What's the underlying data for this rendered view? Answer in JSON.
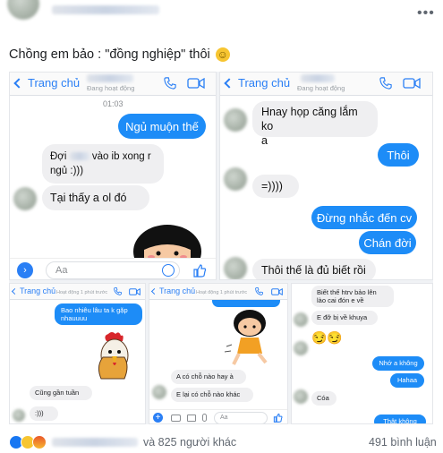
{
  "post": {
    "caption": "Chồng em bảo : \"đồng nghiệp\" thôi",
    "caption_emoji": "☺",
    "menu_icon": "ellipsis-icon"
  },
  "panel1": {
    "back_label": "Trang chủ",
    "status": "Đang hoạt động",
    "time": "01:03",
    "messages": {
      "out1": "Ngủ muộn thế",
      "in1_a": "Đợi",
      "in1_b": "vào ib xong r",
      "in1_c": "ngủ :)))",
      "in2": "Tại thấy a ol đó"
    },
    "composer_placeholder": "Aa"
  },
  "panel2": {
    "back_label": "Trang chủ",
    "status": "Đang hoạt động",
    "messages": {
      "in1_a": "Hnay họp căng lắm ko",
      "in1_b": "a",
      "out1": "Thôi",
      "in2": "=))))",
      "out2": "Đừng nhắc đến cv",
      "out3": "Chán đời",
      "in3": "Thôi thế là đủ biết rồi"
    }
  },
  "panel3": {
    "back_label": "Trang chủ",
    "status": "Hoạt động 1 phút trước",
    "messages": {
      "out1_a": "Bao nhiêu lâu ta k gặp",
      "out1_b": "nhauuuu",
      "in1": "Cũng gần tuần",
      "in2": ":)))"
    }
  },
  "panel4": {
    "back_label": "Trang chủ",
    "status": "Hoạt động 1 phút trước",
    "messages": {
      "in1": "A có chỗ nào hay à",
      "in2": "E lại có chỗ nào khác"
    },
    "composer_placeholder": "Aa"
  },
  "panel5": {
    "messages": {
      "in1_a": "Biết thế htrv bảo lên",
      "in1_b": "lào cai đón e về",
      "in2": "E đỡ bị về khuya",
      "in3": "😏😏",
      "out1": "Nhớ a không",
      "out2": "Hahaa",
      "in4": "Cóa",
      "out3": "Thật không"
    }
  },
  "footer": {
    "reactions_text": "và 825 người khác",
    "comments": "491 bình luận"
  },
  "colors": {
    "messenger_blue": "#1d8cf7",
    "link_blue": "#2a7ff5",
    "incoming_bubble": "#efeff1"
  }
}
